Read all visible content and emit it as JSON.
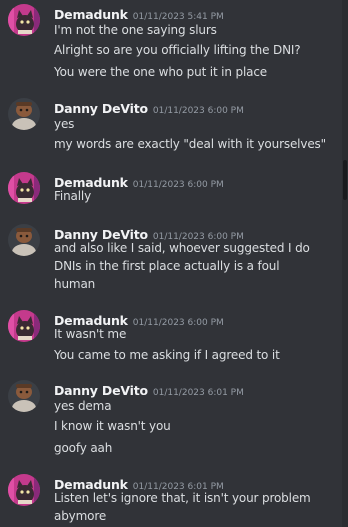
{
  "messages": [
    {
      "author": "Demadunk",
      "timestamp": "01/11/2023 5:41 PM",
      "avatar_icon": "cat-avatar-icon",
      "lines": [
        "I'm not the one saying slurs",
        "Alright so are you officially lifting the DNI?",
        "You were the one who put it in place"
      ]
    },
    {
      "author": "Danny DeVito",
      "timestamp": "01/11/2023 6:00 PM",
      "avatar_icon": "person-avatar-icon",
      "lines": [
        "yes",
        "my words are exactly \"deal with it yourselves\""
      ]
    },
    {
      "author": "Demadunk",
      "timestamp": "01/11/2023 6:00 PM",
      "avatar_icon": "cat-avatar-icon",
      "lines": [
        "Finally"
      ]
    },
    {
      "author": "Danny DeVito",
      "timestamp": "01/11/2023 6:00 PM",
      "avatar_icon": "person-avatar-icon",
      "lines": [
        "and also like I said, whoever suggested I do",
        "DNIs in the first place actually is a foul",
        "human"
      ]
    },
    {
      "author": "Demadunk",
      "timestamp": "01/11/2023 6:00 PM",
      "avatar_icon": "cat-avatar-icon",
      "lines": [
        "It wasn't me",
        "You came to me asking if I agreed to it"
      ]
    },
    {
      "author": "Danny DeVito",
      "timestamp": "01/11/2023 6:01 PM",
      "avatar_icon": "person-avatar-icon",
      "lines": [
        "yes dema",
        "I know it wasn't you",
        "goofy aah"
      ]
    },
    {
      "author": "Demadunk",
      "timestamp": "01/11/2023 6:01 PM",
      "avatar_icon": "cat-avatar-icon",
      "lines": [
        "Listen let's ignore that, it isn't your problem",
        "abymore"
      ]
    }
  ],
  "colors": {
    "background": "#313338",
    "author": "#f2f3f5",
    "timestamp": "#949ba4",
    "text": "#dbdee1"
  }
}
